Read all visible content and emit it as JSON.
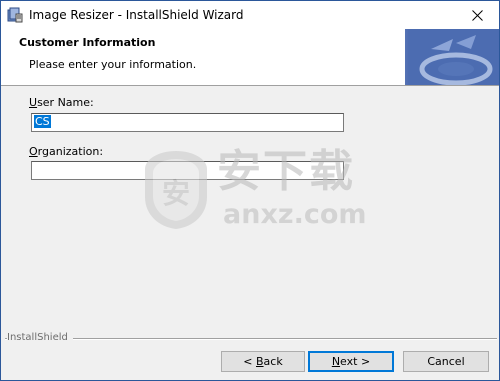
{
  "window": {
    "title": "Image Resizer - InstallShield Wizard",
    "icon": "installer-icon",
    "close_icon": "close-icon"
  },
  "header": {
    "title": "Customer Information",
    "subtitle": "Please enter your information."
  },
  "form": {
    "user_name": {
      "label_accel": "U",
      "label_rest": "ser Name:",
      "value": "CS"
    },
    "organization": {
      "label_accel": "O",
      "label_rest": "rganization:",
      "value": ""
    }
  },
  "watermark": {
    "cn_text": "安下载",
    "en_text": "anxz.com",
    "logo_glyph": "安"
  },
  "footer": {
    "brand": "InstallShield",
    "back": {
      "accel": "< ",
      "accel_char": "B",
      "rest": "ack"
    },
    "next": {
      "accel_char": "N",
      "rest": "ext >"
    },
    "cancel": "Cancel"
  },
  "colors": {
    "accent": "#0078d7",
    "banner_blue": "#3c5ea8"
  }
}
